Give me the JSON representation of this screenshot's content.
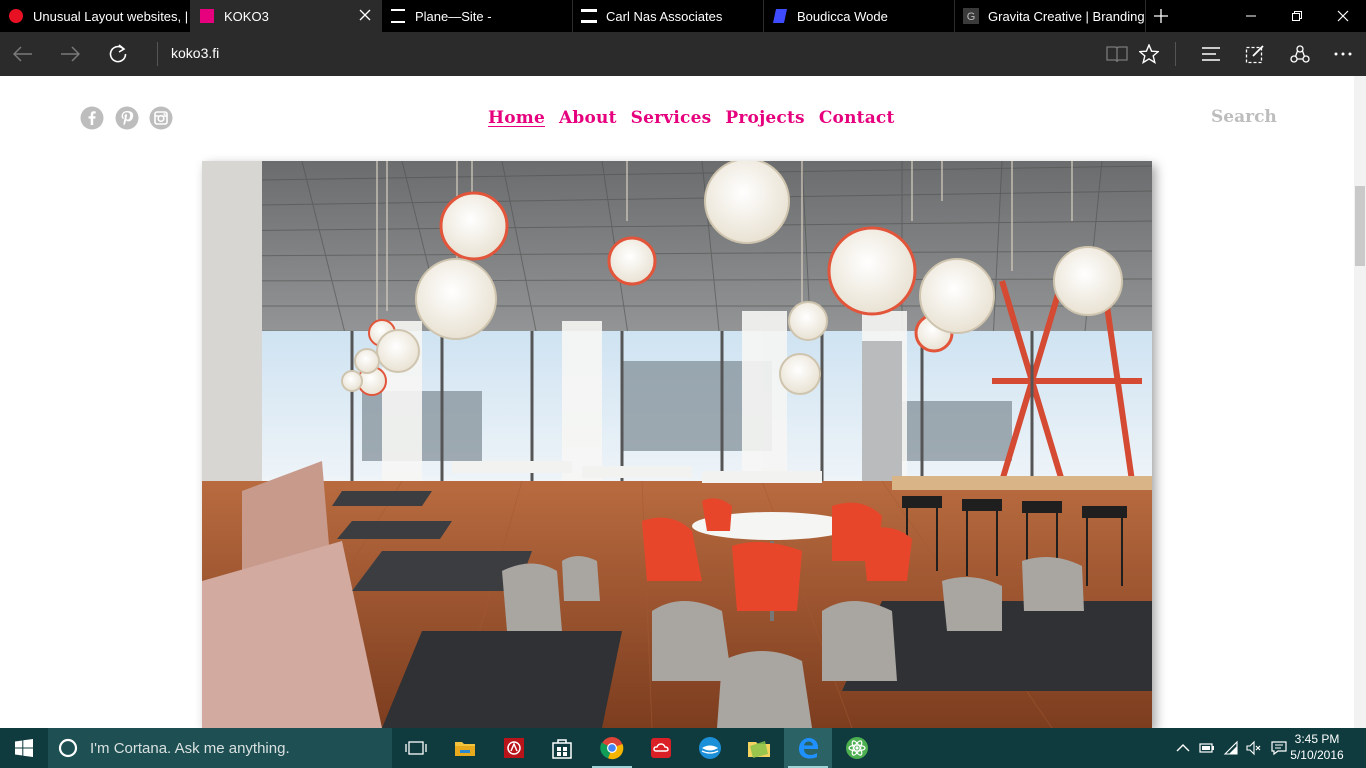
{
  "browser": {
    "tabs": [
      {
        "title": "Unusual Layout websites, |",
        "favicon": "red-circle-icon",
        "color": "#e81123",
        "active": false
      },
      {
        "title": "KOKO3",
        "favicon": "pink-square-icon",
        "color": "#e6007e",
        "active": true
      },
      {
        "title": "Plane—Site -",
        "favicon": "plane-site-icon",
        "color": "#000000",
        "active": false
      },
      {
        "title": "Carl Nas Associates",
        "favicon": "carl-nas-icon",
        "color": "#000000",
        "active": false
      },
      {
        "title": "Boudicca Wode",
        "favicon": "boudicca-icon",
        "color": "#3f4bff",
        "active": false
      },
      {
        "title": "Gravita Creative | Branding",
        "favicon": "gravita-g-icon",
        "color": "#3a3a3a",
        "active": false
      }
    ],
    "url": "koko3.fi"
  },
  "site": {
    "accent_color": "#e6007e",
    "social_icons": [
      "facebook-icon",
      "pinterest-icon",
      "instagram-icon"
    ],
    "nav": {
      "home": "Home",
      "about": "About",
      "services": "Services",
      "projects": "Projects",
      "contact": "Contact"
    },
    "search_label": "Search"
  },
  "taskbar": {
    "cortana_placeholder": "I'm Cortana. Ask me anything.",
    "apps": [
      "task-view-icon",
      "file-explorer-icon",
      "app-red-icon",
      "store-icon",
      "chrome-icon",
      "creative-cloud-icon",
      "cyberduck-icon",
      "folder-app-icon",
      "edge-icon",
      "atom-icon"
    ],
    "time": "3:45 PM",
    "date": "5/10/2016"
  }
}
